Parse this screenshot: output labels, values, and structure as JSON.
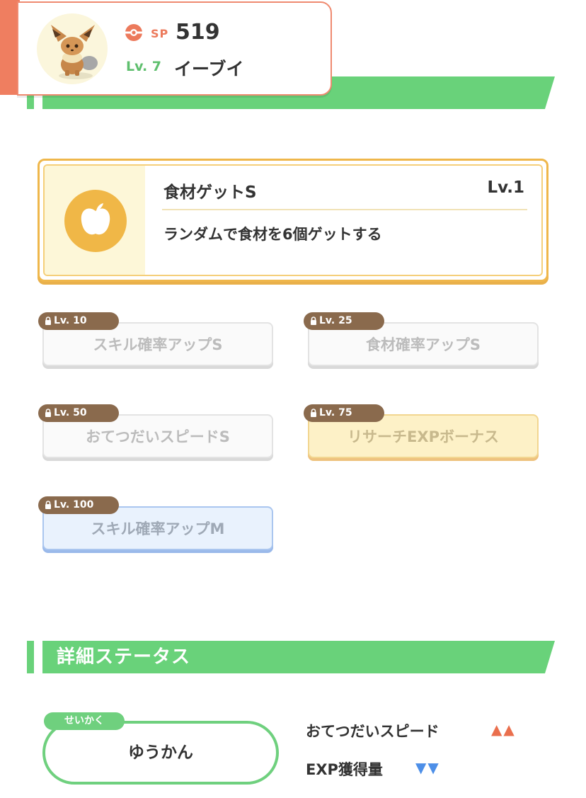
{
  "header": {
    "sp_label": "SP",
    "sp_value": "519",
    "level": "Lv. 7",
    "pokemon_name": "イーブイ"
  },
  "main_skill": {
    "name": "食材ゲットS",
    "level": "Lv.1",
    "description": "ランダムで食材を6個ゲットする"
  },
  "sub_skills": [
    {
      "unlock_level": "Lv. 10",
      "name": "スキル確率アップS"
    },
    {
      "unlock_level": "Lv. 25",
      "name": "食材確率アップS"
    },
    {
      "unlock_level": "Lv. 50",
      "name": "おてつだいスピードS"
    },
    {
      "unlock_level": "Lv. 75",
      "name": "リサーチEXPボーナス"
    },
    {
      "unlock_level": "Lv. 100",
      "name": "スキル確率アップM"
    }
  ],
  "detail_section": {
    "title": "詳細ステータス"
  },
  "nature": {
    "tag": "せいかく",
    "value": "ゆうかん",
    "up_effect": "おてつだいスピード",
    "up_arrows": "▲▲",
    "down_effect": "EXP獲得量",
    "down_arrows": "▼▼"
  },
  "colors": {
    "accent_green": "#69d27a",
    "sp_orange": "#ec7a5c",
    "lock_brown": "#8a6a4d",
    "main_skill_gold": "#f0b747",
    "up_red": "#ea6f4d",
    "down_blue": "#4d8fe8"
  }
}
